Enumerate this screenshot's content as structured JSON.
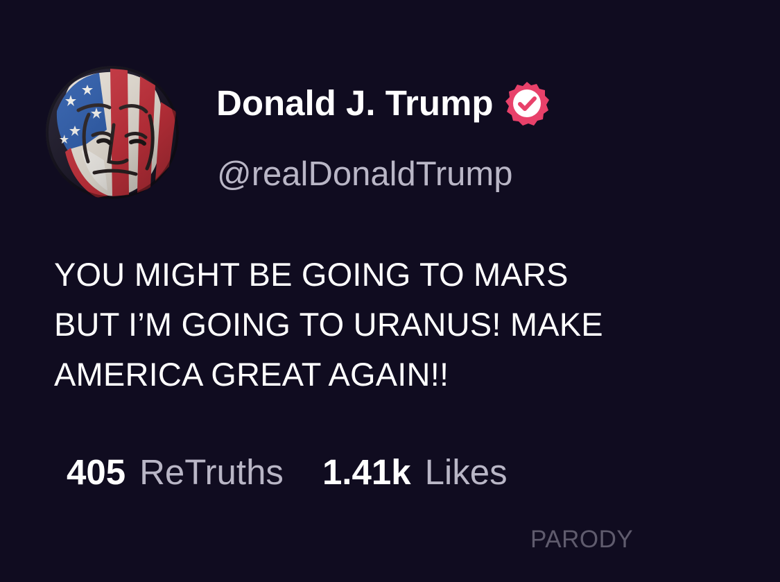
{
  "post": {
    "author": {
      "display_name": "Donald J. Trump",
      "handle": "@realDonaldTrump",
      "avatar_icon": "flag-face-avatar-icon",
      "verified_icon": "verified-badge-icon",
      "verified_color": "#e8416a"
    },
    "text_lines": [
      "YOU MIGHT BE GOING TO MARS",
      "BUT I’M GOING TO URANUS! MAKE",
      "AMERICA GREAT AGAIN!!"
    ],
    "stats": {
      "retruths_count": "405",
      "retruths_label": "ReTruths",
      "likes_count": "1.41k",
      "likes_label": "Likes"
    },
    "watermark": "PARODY"
  },
  "colors": {
    "background": "#100c20",
    "primary_text": "#ffffff",
    "secondary_text": "#b9b6c6",
    "watermark_text": "#5f5b6d",
    "flag_red": "#c7323d",
    "flag_blue": "#2d5cab"
  }
}
